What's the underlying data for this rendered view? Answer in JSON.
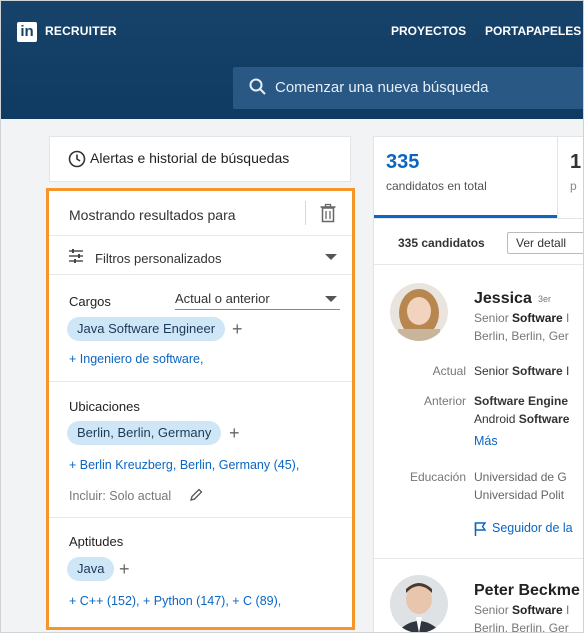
{
  "topbar": {
    "logo": "in",
    "brand": "RECRUITER",
    "nav": [
      "PROYECTOS",
      "PORTAPAPELES"
    ],
    "search_placeholder": "Comenzar una nueva búsqueda"
  },
  "left": {
    "alert_text": "Alertas e historial de búsquedas",
    "filters_header": "Mostrando resultados para",
    "custom_filters": "Filtros personalizados",
    "cargos": {
      "title": "Cargos",
      "select": "Actual o anterior",
      "chip": "Java Software Engineer",
      "suggestion": "+ Ingeniero de software,"
    },
    "ubicaciones": {
      "title": "Ubicaciones",
      "chip": "Berlin, Berlin, Germany",
      "suggestion": "+ Berlin Kreuzberg, Berlin, Germany (45),",
      "include": "Incluir: Solo actual"
    },
    "aptitudes": {
      "title": "Aptitudes",
      "chip": "Java",
      "suggestion": "+ C++ (152), + Python (147), + C (89),"
    }
  },
  "right": {
    "total_count": "335",
    "total_label": "candidatos en total",
    "second_count": "1",
    "second_label": "p",
    "row_count": "335 candidatos",
    "detail_button": "Ver detall",
    "candidates": [
      {
        "name": "Jessica",
        "degree": "3er",
        "headline_pre": "Senior ",
        "headline_bold": "Software",
        "headline_post": " I",
        "location": "Berlin, Berlin, Ger",
        "actual_label": "Actual",
        "actual_pre": "Senior ",
        "actual_bold": "Software",
        "actual_post": " I",
        "anterior_label": "Anterior",
        "anterior_1": "Software Engine",
        "anterior_2_pre": "Android ",
        "anterior_2_bold": "Software",
        "more": "Más",
        "edu_label": "Educación",
        "edu_1": "Universidad de G",
        "edu_2": "Universidad Polit",
        "follow": "Seguidor de la"
      },
      {
        "name": "Peter Beckme",
        "headline_pre": "Senior ",
        "headline_bold": "Software",
        "headline_post": " I",
        "location": "Berlin, Berlin, Ger"
      }
    ]
  },
  "colors": {
    "nav_bg": "#17436b",
    "accent_blue": "#0a66c2",
    "highlight_border": "#f5962a",
    "chip_bg": "#cfe6f7"
  }
}
